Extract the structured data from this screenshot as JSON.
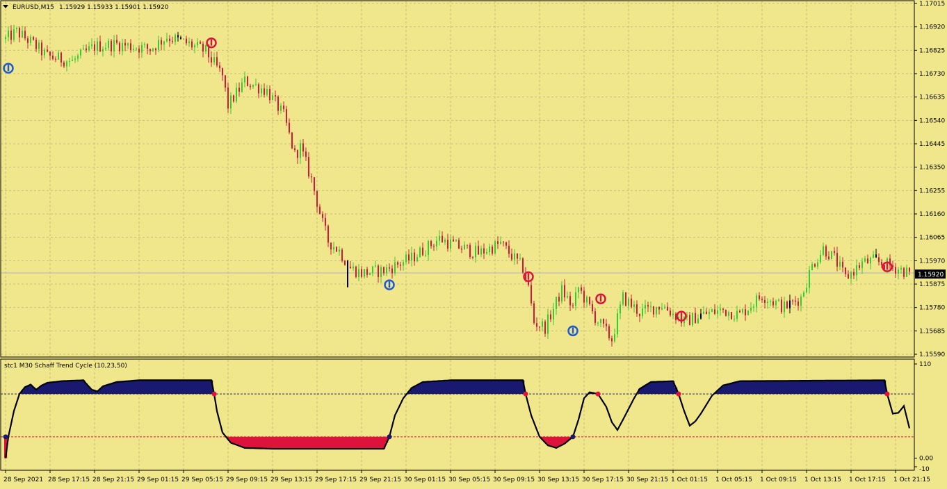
{
  "window": {
    "symbol_label": "EURUSD,M15",
    "ohlc_label": "1.15929 1.15933 1.15901 1.15920",
    "menu_arrow_icon": "triangle-down-icon"
  },
  "colors": {
    "background": "#F0E68C",
    "grid": "#C8BE78",
    "bull": "#32CD32",
    "bear": "#DC143C",
    "doji": "#000000",
    "stc_up": "#191970",
    "stc_down": "#DC143C",
    "stc_line": "#000000",
    "bid_line": "#B4B4B4",
    "buy_arrow": "#1E5AD2",
    "sell_arrow": "#DC143C"
  },
  "chart_data": [
    {
      "type": "candlestick",
      "title": "EURUSD,M15",
      "ylim": [
        1.1559,
        1.17015
      ],
      "price_ticks": [
        "1.17015",
        "1.16920",
        "1.16825",
        "1.16730",
        "1.16635",
        "1.16540",
        "1.16445",
        "1.16350",
        "1.16255",
        "1.16160",
        "1.16065",
        "1.15970",
        "1.15875",
        "1.15780",
        "1.15685",
        "1.15590"
      ],
      "current_price": "1.15920",
      "x_ticks": [
        "28 Sep 2021",
        "28 Sep 17:15",
        "28 Sep 21:15",
        "29 Sep 01:15",
        "29 Sep 05:15",
        "29 Sep 09:15",
        "29 Sep 13:15",
        "29 Sep 17:15",
        "29 Sep 21:15",
        "30 Sep 01:15",
        "30 Sep 05:15",
        "30 Sep 09:15",
        "30 Sep 13:15",
        "30 Sep 17:15",
        "30 Sep 21:15",
        "1 Oct 01:15",
        "1 Oct 05:15",
        "1 Oct 09:15",
        "1 Oct 13:15",
        "1 Oct 17:15",
        "1 Oct 21:15"
      ],
      "x_tick_index": [
        0,
        16,
        32,
        48,
        64,
        80,
        96,
        112,
        128,
        144,
        160,
        176,
        192,
        208,
        224,
        240,
        256,
        272,
        288,
        304,
        320
      ],
      "bar_count": 326,
      "close_path": [
        [
          0,
          1.1687
        ],
        [
          4,
          1.169
        ],
        [
          10,
          1.1685
        ],
        [
          15,
          1.168
        ],
        [
          24,
          1.1678
        ],
        [
          32,
          1.1684
        ],
        [
          40,
          1.1685
        ],
        [
          52,
          1.1683
        ],
        [
          58,
          1.1688
        ],
        [
          66,
          1.1685
        ],
        [
          72,
          1.1682
        ],
        [
          78,
          1.1672
        ],
        [
          80,
          1.166
        ],
        [
          86,
          1.167
        ],
        [
          94,
          1.1666
        ],
        [
          100,
          1.1656
        ],
        [
          104,
          1.164
        ],
        [
          106,
          1.1643
        ],
        [
          110,
          1.163
        ],
        [
          114,
          1.1612
        ],
        [
          116,
          1.1605
        ],
        [
          120,
          1.1601
        ],
        [
          124,
          1.1594
        ],
        [
          128,
          1.1592
        ],
        [
          136,
          1.1593
        ],
        [
          146,
          1.1598
        ],
        [
          156,
          1.1606
        ],
        [
          162,
          1.1603
        ],
        [
          170,
          1.16
        ],
        [
          178,
          1.1604
        ],
        [
          186,
          1.1594
        ],
        [
          188,
          1.1586
        ],
        [
          190,
          1.1572
        ],
        [
          194,
          1.157
        ],
        [
          200,
          1.1585
        ],
        [
          204,
          1.1578
        ],
        [
          206,
          1.1586
        ],
        [
          212,
          1.1574
        ],
        [
          218,
          1.1565
        ],
        [
          222,
          1.1582
        ],
        [
          228,
          1.1576
        ],
        [
          236,
          1.1579
        ],
        [
          244,
          1.1572
        ],
        [
          250,
          1.1575
        ],
        [
          258,
          1.1577
        ],
        [
          264,
          1.1575
        ],
        [
          272,
          1.1583
        ],
        [
          280,
          1.1578
        ],
        [
          286,
          1.1582
        ],
        [
          290,
          1.1595
        ],
        [
          294,
          1.1602
        ],
        [
          298,
          1.1598
        ],
        [
          302,
          1.159
        ],
        [
          308,
          1.1596
        ],
        [
          312,
          1.1597
        ],
        [
          318,
          1.1595
        ],
        [
          325,
          1.1592
        ]
      ],
      "doji_bars": [
        62,
        63,
        123,
        250,
        282,
        313
      ],
      "signals": [
        {
          "bar": 1,
          "price": 1.16752,
          "dir": "buy"
        },
        {
          "bar": 74,
          "price": 1.16855,
          "dir": "sell"
        },
        {
          "bar": 138,
          "price": 1.15872,
          "dir": "buy"
        },
        {
          "bar": 188,
          "price": 1.15905,
          "dir": "sell"
        },
        {
          "bar": 204,
          "price": 1.15685,
          "dir": "buy"
        },
        {
          "bar": 214,
          "price": 1.15815,
          "dir": "sell"
        },
        {
          "bar": 243,
          "price": 1.15745,
          "dir": "sell"
        },
        {
          "bar": 317,
          "price": 1.15945,
          "dir": "sell"
        }
      ]
    },
    {
      "type": "area",
      "title": "stc1 M30 Schaff Trend Cycle (10,23,50)",
      "ylim": [
        -10,
        110
      ],
      "y_ticks": [
        "110",
        "0.00",
        "-10"
      ],
      "levels": [
        75,
        25
      ],
      "values_path": [
        [
          0,
          0
        ],
        [
          1,
          25
        ],
        [
          3,
          55
        ],
        [
          5,
          75
        ],
        [
          7,
          83
        ],
        [
          9,
          86
        ],
        [
          11,
          80
        ],
        [
          13,
          85
        ],
        [
          15,
          88
        ],
        [
          20,
          90
        ],
        [
          28,
          91
        ],
        [
          29,
          87
        ],
        [
          31,
          80
        ],
        [
          33,
          78
        ],
        [
          35,
          84
        ],
        [
          40,
          89
        ],
        [
          48,
          91
        ],
        [
          74,
          91
        ],
        [
          75,
          75
        ],
        [
          76,
          55
        ],
        [
          78,
          30
        ],
        [
          81,
          18
        ],
        [
          86,
          12
        ],
        [
          96,
          11
        ],
        [
          136,
          11
        ],
        [
          138,
          25
        ],
        [
          140,
          50
        ],
        [
          143,
          70
        ],
        [
          146,
          82
        ],
        [
          150,
          89
        ],
        [
          160,
          91
        ],
        [
          186,
          91
        ],
        [
          187,
          75
        ],
        [
          189,
          50
        ],
        [
          192,
          25
        ],
        [
          195,
          15
        ],
        [
          198,
          12
        ],
        [
          201,
          17
        ],
        [
          204,
          25
        ],
        [
          206,
          45
        ],
        [
          208,
          70
        ],
        [
          210,
          77
        ],
        [
          213,
          75
        ],
        [
          216,
          60
        ],
        [
          218,
          42
        ],
        [
          220,
          33
        ],
        [
          222,
          45
        ],
        [
          226,
          70
        ],
        [
          228,
          81
        ],
        [
          232,
          89
        ],
        [
          240,
          90
        ],
        [
          242,
          75
        ],
        [
          244,
          55
        ],
        [
          246,
          38
        ],
        [
          248,
          43
        ],
        [
          250,
          52
        ],
        [
          254,
          73
        ],
        [
          258,
          85
        ],
        [
          264,
          90
        ],
        [
          316,
          91
        ],
        [
          317,
          75
        ],
        [
          319,
          52
        ],
        [
          321,
          53
        ],
        [
          323,
          61
        ],
        [
          325,
          35
        ]
      ],
      "dots": [
        {
          "bar": 0,
          "value": 25,
          "dir": "up"
        },
        {
          "bar": 75,
          "value": 75,
          "dir": "down"
        },
        {
          "bar": 138,
          "value": 25,
          "dir": "up"
        },
        {
          "bar": 187,
          "value": 75,
          "dir": "down"
        },
        {
          "bar": 204,
          "value": 25,
          "dir": "up"
        },
        {
          "bar": 213,
          "value": 75,
          "dir": "down"
        },
        {
          "bar": 242,
          "value": 75,
          "dir": "down"
        },
        {
          "bar": 317,
          "value": 75,
          "dir": "down"
        }
      ]
    }
  ]
}
